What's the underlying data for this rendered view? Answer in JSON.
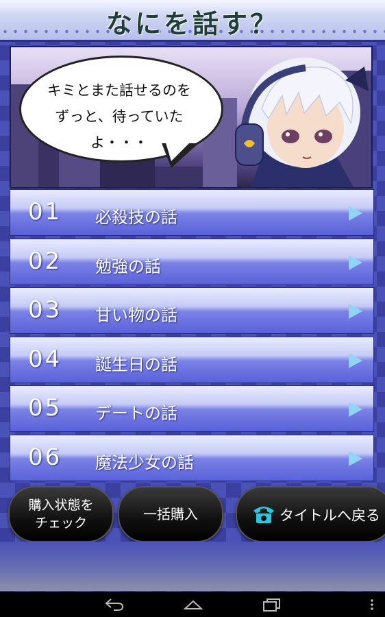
{
  "header": {
    "title": "なにを話す？"
  },
  "banner": {
    "speech_line1": "キミとまた話せるのを",
    "speech_line2": "ずっと、待っていたよ・・・"
  },
  "menu": [
    {
      "number": "01",
      "label": "必殺技の話"
    },
    {
      "number": "02",
      "label": "勉強の話"
    },
    {
      "number": "03",
      "label": "甘い物の話"
    },
    {
      "number": "04",
      "label": "誕生日の話"
    },
    {
      "number": "05",
      "label": "デートの話"
    },
    {
      "number": "06",
      "label": "魔法少女の話"
    }
  ],
  "buttons": {
    "check_line1": "購入状態を",
    "check_line2": "チェック",
    "buy_all": "一括購入",
    "back_to_title": "タイトルへ戻る"
  },
  "colors": {
    "menu_arrow": "#8fd6f5",
    "phone_icon": "#29c7e0"
  },
  "icons": {
    "back": "back-arrow-icon",
    "home": "home-icon",
    "recents": "recents-icon",
    "overflow": "overflow-menu-icon",
    "phone": "phone-icon"
  }
}
